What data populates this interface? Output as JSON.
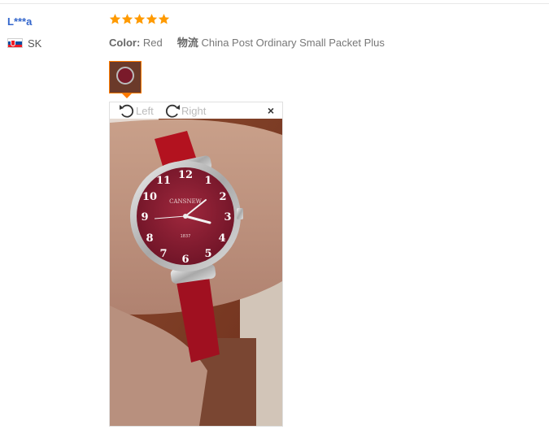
{
  "review": {
    "user_name": "L***a",
    "country_code": "SK",
    "rating": 5,
    "color_label": "Color:",
    "color_value": "Red",
    "shipping_label": "物流",
    "shipping_value": "China Post Ordinary Small Packet Plus"
  },
  "viewer": {
    "rotate_left": "Left",
    "rotate_right": "Right",
    "close": "×"
  },
  "watch": {
    "brand": "CANSNEW",
    "numbers": [
      "12",
      "1",
      "2",
      "3",
      "4",
      "5",
      "6",
      "7",
      "8",
      "9",
      "10",
      "11"
    ],
    "sub": "1837"
  },
  "colors": {
    "star": "#ff9a00",
    "user_link": "#3366cc",
    "thumb_border": "#ff7a00"
  }
}
